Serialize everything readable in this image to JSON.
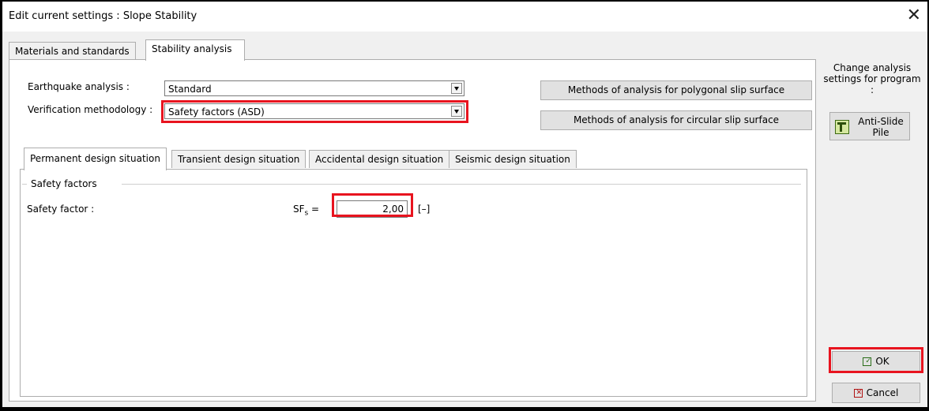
{
  "window": {
    "title": "Edit current settings : Slope Stability",
    "close_glyph": "✕"
  },
  "top_tabs": [
    {
      "label": "Materials and standards",
      "active": false
    },
    {
      "label": "Stability analysis",
      "active": true
    }
  ],
  "form": {
    "earthquake_label": "Earthquake analysis :",
    "earthquake_value": "Standard",
    "verification_label": "Verification methodology :",
    "verification_value": "Safety factors (ASD)"
  },
  "methods_buttons": {
    "polygonal": "Methods of analysis for polygonal slip surface",
    "circular": "Methods of analysis for circular slip surface"
  },
  "situation_tabs": [
    {
      "label": "Permanent design situation",
      "active": true
    },
    {
      "label": "Transient design situation",
      "active": false
    },
    {
      "label": "Accidental design situation",
      "active": false
    },
    {
      "label": "Seismic design situation",
      "active": false
    }
  ],
  "safety": {
    "section_title": "Safety factors",
    "factor_label": "Safety factor :",
    "sf_symbol": "SF",
    "sf_subscript": "s",
    "sf_equals": " =",
    "sf_value": "2,00",
    "unit": "[–]"
  },
  "side_panel": {
    "change_text": "Change analysis settings for program :",
    "anti_slide_label": "Anti-Slide Pile",
    "ok_label": "OK",
    "cancel_label": "Cancel"
  },
  "colors": {
    "highlight": "#e8141f",
    "dialog_bg": "#f0f0f0",
    "button_bg": "#e1e1e1"
  },
  "icons": [
    "close-icon",
    "dropdown-arrow-icon",
    "anti-slide-pile-icon",
    "ok-check-icon",
    "cancel-x-icon"
  ]
}
